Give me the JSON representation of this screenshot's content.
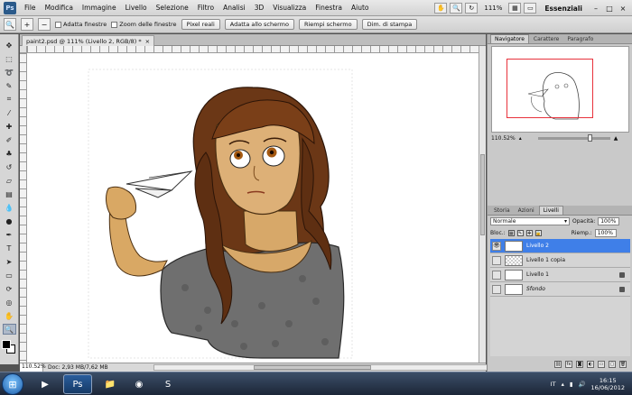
{
  "menubar": {
    "logo": "Ps",
    "items": [
      "File",
      "Modifica",
      "Immagine",
      "Livello",
      "Selezione",
      "Filtro",
      "Analisi",
      "3D",
      "Visualizza",
      "Finestra",
      "Aiuto"
    ],
    "zoom": "111%",
    "workspace": "Essenziali",
    "window_buttons": [
      "–",
      "□",
      "×"
    ]
  },
  "options": {
    "adatta_finestre": "Adatta finestre",
    "zoom_delle_finestre": "Zoom delle finestre",
    "pixel_reali": "Pixel reali",
    "adatta_allo_schermo": "Adatta allo schermo",
    "riempi_schermo": "Riempi schermo",
    "dim_di_stampa": "Dim. di stampa"
  },
  "document": {
    "tab_title": "paint2.psd @ 111% (Livello 2, RGB/8) *",
    "close": "×",
    "zoom": "110.52%",
    "doc_info": "Doc: 2,93 MB/7,62 MB"
  },
  "tools": [
    "move",
    "marquee",
    "lasso",
    "quick-select",
    "crop",
    "eyedropper",
    "healing",
    "brush",
    "clone-stamp",
    "history-brush",
    "eraser",
    "gradient",
    "blur",
    "dodge",
    "pen",
    "type",
    "path-select",
    "shape",
    "3d-rotate",
    "3d-orbit",
    "hand",
    "zoom"
  ],
  "navigator": {
    "tabs": [
      "Navigatore",
      "Carattere",
      "Paragrafo"
    ],
    "zoom": "110.52%"
  },
  "layers_panel": {
    "tabs": [
      "Storia",
      "Azioni",
      "Livelli"
    ],
    "blend_mode": "Normale",
    "opacity_label": "Opacità:",
    "opacity_value": "100%",
    "lock_label": "Bloc.:",
    "fill_label": "Riemp.:",
    "fill_value": "100%",
    "layers": [
      {
        "name": "Livello 2",
        "selected": true
      },
      {
        "name": "Livello 1 copia",
        "selected": false
      },
      {
        "name": "Livello 1",
        "selected": false
      },
      {
        "name": "Sfondo",
        "selected": false
      }
    ]
  },
  "taskbar": {
    "lang": "IT",
    "time": "16:15",
    "date": "16/06/2012"
  },
  "colors": {
    "accent_selected": "#3f7fe8",
    "navigator_frame": "#e8323c"
  }
}
